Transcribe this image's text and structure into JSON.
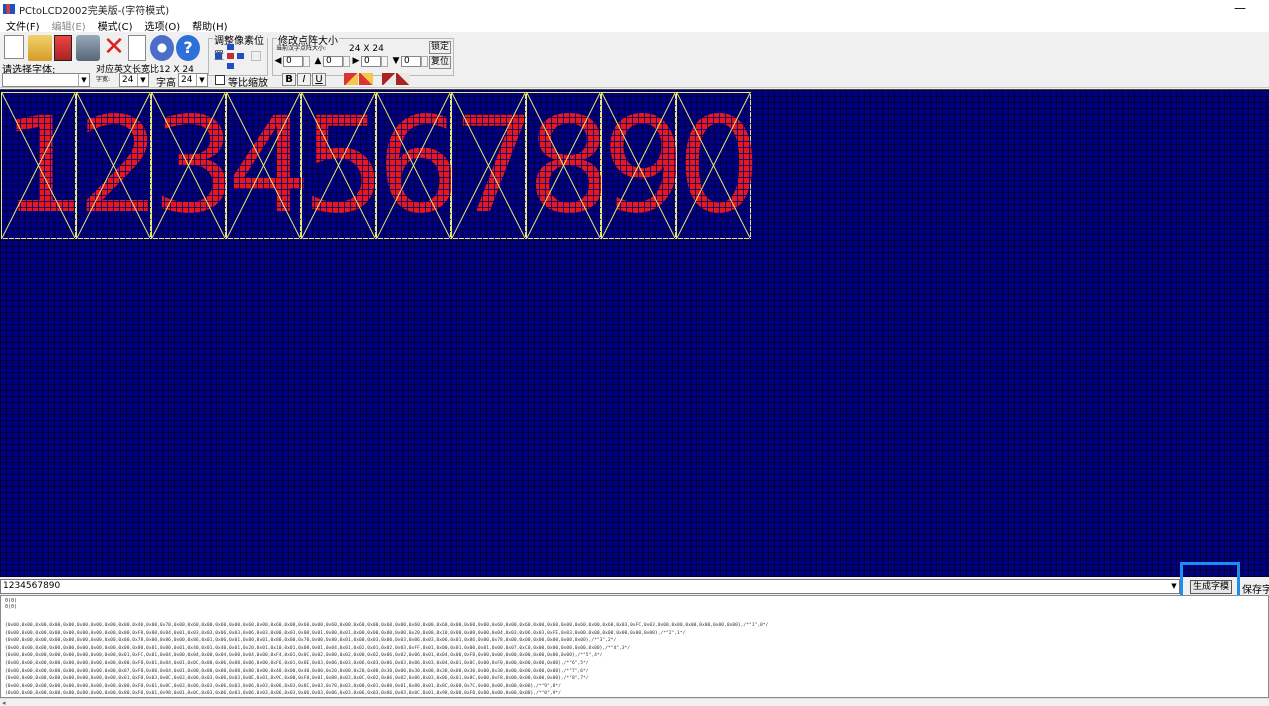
{
  "window": {
    "title": "PCtoLCD2002完美版-(字符模式)",
    "minimize_glyph": "—"
  },
  "menu": [
    "文件(F)",
    "编辑(E)",
    "模式(C)",
    "选项(O)",
    "帮助(H)"
  ],
  "toolbar": {
    "adjust_pixel_label": "调整像素位置",
    "dot_size_label": "修改点阵大小",
    "current_size_label": "当前汉字点阵大小:",
    "current_size_value": "24 X 24",
    "spin_left": "0",
    "spin_up": "0",
    "spin_right": "0",
    "spin_down": "0",
    "lock_label": "锁定",
    "reset_label": "复位"
  },
  "font": {
    "select_font_label": "请选择字体:",
    "en_char_ratio_label": "对应英文长宽比12 X 24",
    "char_width_label": "字宽:",
    "char_width_value": "24",
    "char_height_label": "字高",
    "char_height_value": "24",
    "proportional_label": "等比缩放",
    "bold": "B",
    "italic": "I",
    "underline": "U"
  },
  "glyphs": [
    "1",
    "2",
    "3",
    "4",
    "5",
    "6",
    "7",
    "8",
    "9",
    "0"
  ],
  "colors": {
    "canvas_bg": "#000080",
    "dot_on": "#e81818",
    "cell_border": "#e8e870",
    "highlight": "#1a8ff0"
  },
  "input": {
    "value": "1234567890",
    "generate_label": "生成字模",
    "save_label": "保存字"
  },
  "output": {
    "header": [
      "0(0)",
      "0(0)"
    ],
    "lines": [
      "{0x00,0x00,0x00,0x00,0x00,0x00,0x00,0x00,0x00,0x40,0x00,0x70,0x00,0x60,0x00,0x60,0x00,0x60,0x00,0x60,0x00,0x60,0x00,0x60,0x00,0x60,0x00,0x60,0x00,0x60,0x00,0x60,0x00,0x60,0x00,0x60,0x00,0x60,0x00,0x60,0x00,0x60,0x00,0x60,0x03,0xFC,0x03,0x00,0x00,0x00,0x00,0x00,0x00},/*\"1\",0*/",
      "{0x00,0x00,0x00,0x00,0x00,0x00,0x00,0x00,0x00,0xF8,0x00,0x84,0x01,0x03,0x03,0x06,0x03,0x06,0x03,0x00,0x03,0x00,0x01,0x80,0x01,0x00,0x00,0x80,0x00,0x20,0x00,0x10,0x00,0x08,0x00,0x04,0x03,0x06,0x03,0xFE,0x03,0x00,0x00,0x00,0x00,0x00,0x00},/*\"2\",1*/",
      "{0x00,0x00,0x00,0x00,0x00,0x00,0x00,0x00,0x00,0x78,0x00,0x86,0x00,0x86,0x01,0x06,0x01,0x80,0x01,0x80,0x00,0x70,0x00,0x80,0x01,0x00,0x03,0x00,0x03,0x06,0x03,0x06,0x01,0x86,0x00,0x78,0x00,0x00,0x00,0x00,0x00,0x00},/*\"3\",2*/",
      "{0x00,0x00,0x00,0x00,0x00,0x00,0x00,0x00,0x00,0x80,0x01,0x80,0x01,0x40,0x01,0x40,0x01,0x20,0x01,0x10,0x01,0x08,0x01,0x04,0x01,0x02,0x01,0x02,0x03,0xFF,0x01,0x00,0x01,0x00,0x01,0x00,0x07,0xC0,0x00,0x00,0x00,0x00,0x00},/*\"4\",3*/",
      "{0x00,0x00,0x00,0x00,0x00,0x00,0x00,0x00,0x01,0xFC,0x01,0x04,0x00,0x04,0x00,0x04,0x00,0x04,0x00,0xF4,0x01,0x0C,0x02,0x00,0x02,0x00,0x02,0x06,0x02,0x06,0x01,0x04,0x00,0xF8,0x00,0x00,0x00,0x00,0x00,0x00,0x00},/*\"5\",4*/",
      "{0x00,0x00,0x00,0x00,0x00,0x00,0x00,0x00,0x00,0xF8,0x01,0x84,0x01,0x0C,0x00,0x06,0x00,0x06,0x00,0xF6,0x01,0x0E,0x03,0x06,0x03,0x06,0x03,0x06,0x03,0x06,0x03,0x04,0x01,0x0C,0x00,0xF0,0x00,0x00,0x00,0x00},/*\"6\",5*/",
      "{0x00,0x00,0x00,0x00,0x00,0x00,0x00,0x00,0x07,0xF8,0x00,0x04,0x01,0x00,0x00,0x80,0x00,0x80,0x00,0x40,0x00,0x40,0x00,0x20,0x00,0x20,0x00,0x30,0x00,0x30,0x00,0x30,0x00,0x30,0x00,0x30,0x00,0x00,0x00,0x00},/*\"7\",6*/",
      "{0x00,0x00,0x00,0x00,0x00,0x00,0x00,0x00,0x01,0xF0,0x03,0x0C,0x03,0x06,0x03,0x06,0x03,0x0E,0x01,0x9C,0x00,0xF0,0x01,0xB8,0x03,0x0C,0x02,0x06,0x02,0x06,0x03,0x06,0x01,0x8C,0x00,0xF8,0x00,0x00,0x00,0x00},/*\"8\",7*/",
      "{0x00,0x00,0x00,0x00,0x00,0x00,0x00,0x00,0x00,0xF0,0x01,0x8C,0x03,0x06,0x03,0x06,0x03,0x06,0x03,0x06,0x03,0x8C,0x03,0x78,0x03,0x00,0x01,0x80,0x01,0x80,0x01,0x8C,0x00,0x7C,0x00,0x00,0x00,0x00},/*\"9\",8*/",
      "{0x00,0x00,0x00,0x00,0x00,0x00,0x00,0x00,0x00,0xF0,0x01,0x98,0x01,0x0C,0x03,0x06,0x03,0x06,0x03,0x06,0x03,0x06,0x03,0x06,0x03,0x06,0x03,0x06,0x03,0x0C,0x01,0x98,0x00,0xF0,0x00,0x00,0x00,0x00},/*\"0\",9*/"
    ]
  }
}
